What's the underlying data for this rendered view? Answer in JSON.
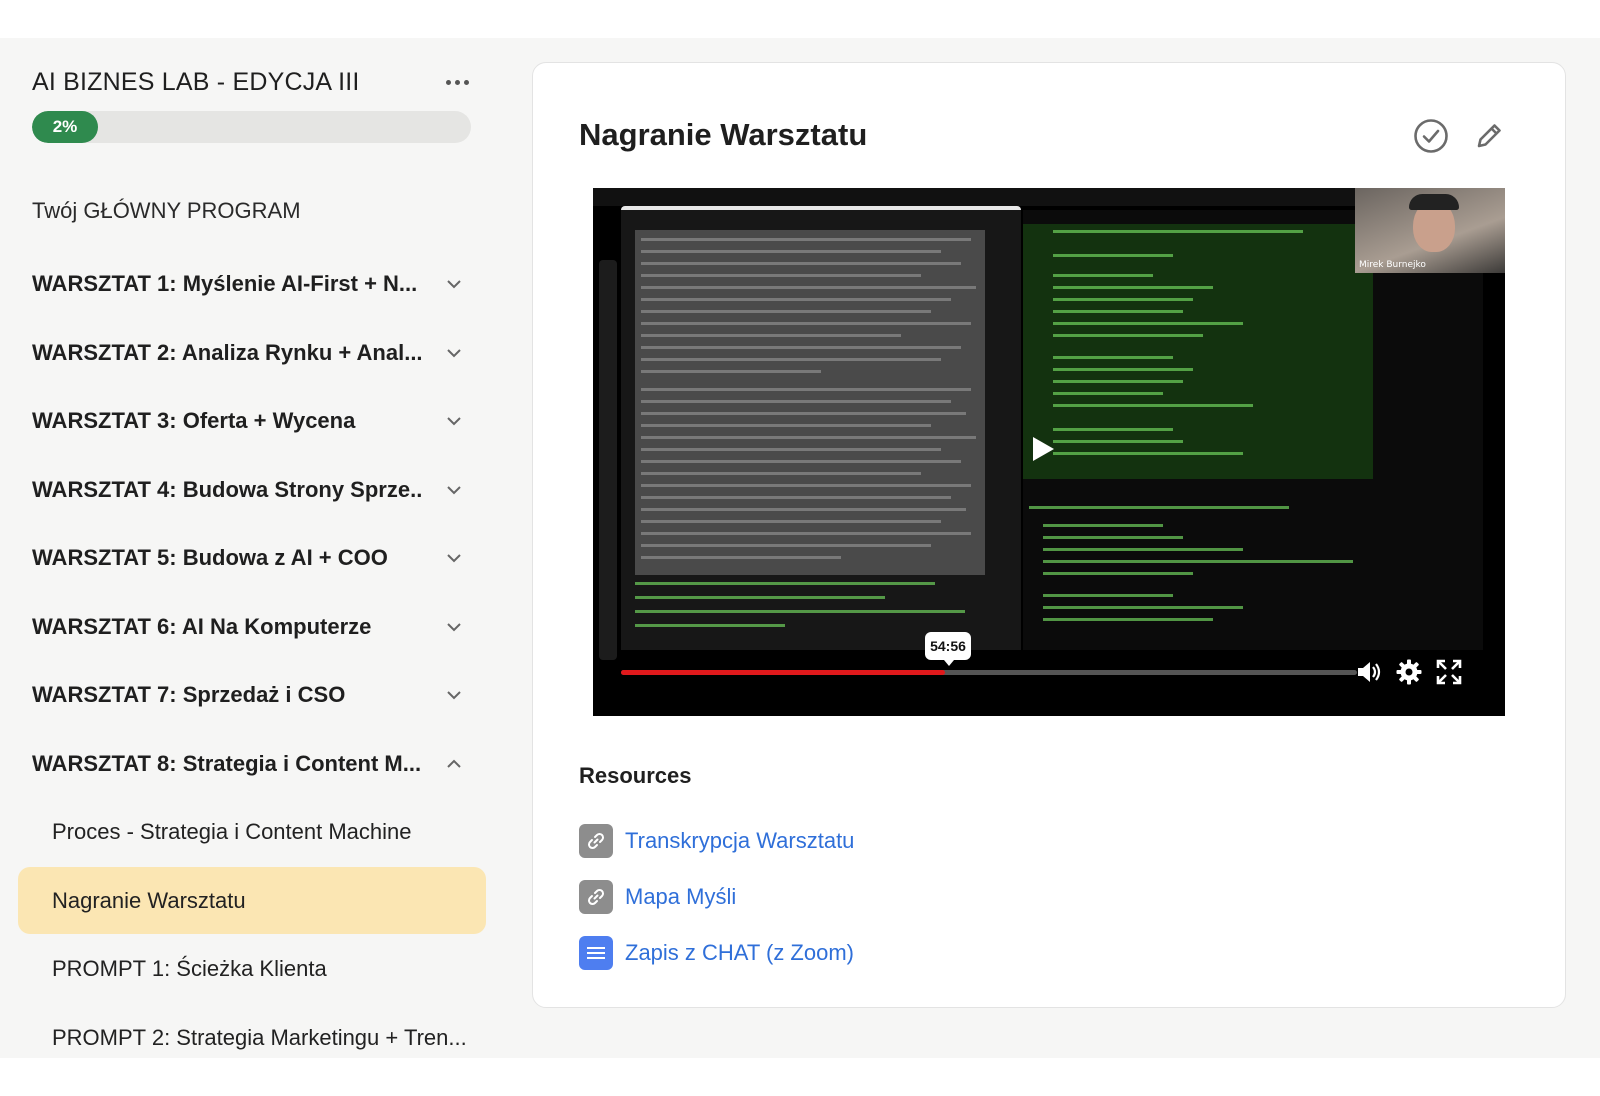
{
  "course": {
    "title": "AI BIZNES LAB - EDYCJA III",
    "progress_label": "2%",
    "progress_value": 0.02
  },
  "program_title": "Twój GŁÓWNY PROGRAM",
  "workshops": [
    {
      "label": "WARSZTAT 1: Myślenie AI-First + N...",
      "expanded": false
    },
    {
      "label": "WARSZTAT 2: Analiza Rynku + Anal...",
      "expanded": false
    },
    {
      "label": "WARSZTAT 3: Oferta + Wycena",
      "expanded": false
    },
    {
      "label": "WARSZTAT 4: Budowa Strony Sprze...",
      "expanded": false
    },
    {
      "label": "WARSZTAT 5: Budowa z AI + COO",
      "expanded": false
    },
    {
      "label": "WARSZTAT 6: AI Na Komputerze",
      "expanded": false
    },
    {
      "label": "WARSZTAT 7: Sprzedaż i CSO",
      "expanded": false
    },
    {
      "label": "WARSZTAT 8: Strategia i Content M...",
      "expanded": true
    }
  ],
  "lessons": [
    {
      "label": "Proces - Strategia i Content Machine",
      "active": false
    },
    {
      "label": "Nagranie Warsztatu",
      "active": true
    },
    {
      "label": "PROMPT 1: Ścieżka Klienta",
      "active": false
    },
    {
      "label": "PROMPT 2: Strategia Marketingu + Tren...",
      "active": false
    }
  ],
  "main": {
    "title": "Nagranie Warsztatu",
    "video": {
      "time_tooltip": "54:56",
      "progress": 0.44,
      "presenter_name": "Mirek Burnejko"
    },
    "resources_title": "Resources",
    "resources": [
      {
        "label": "Transkrypcja Warsztatu",
        "icon": "link-icon"
      },
      {
        "label": "Mapa Myśli",
        "icon": "link-icon"
      },
      {
        "label": "Zapis z CHAT (z Zoom)",
        "icon": "document-icon"
      }
    ]
  },
  "colors": {
    "progress_green": "#2f8a4e",
    "active_lesson_bg": "#fbe6b3",
    "link_blue": "#2f6fd9",
    "seek_red": "#e0191c"
  }
}
